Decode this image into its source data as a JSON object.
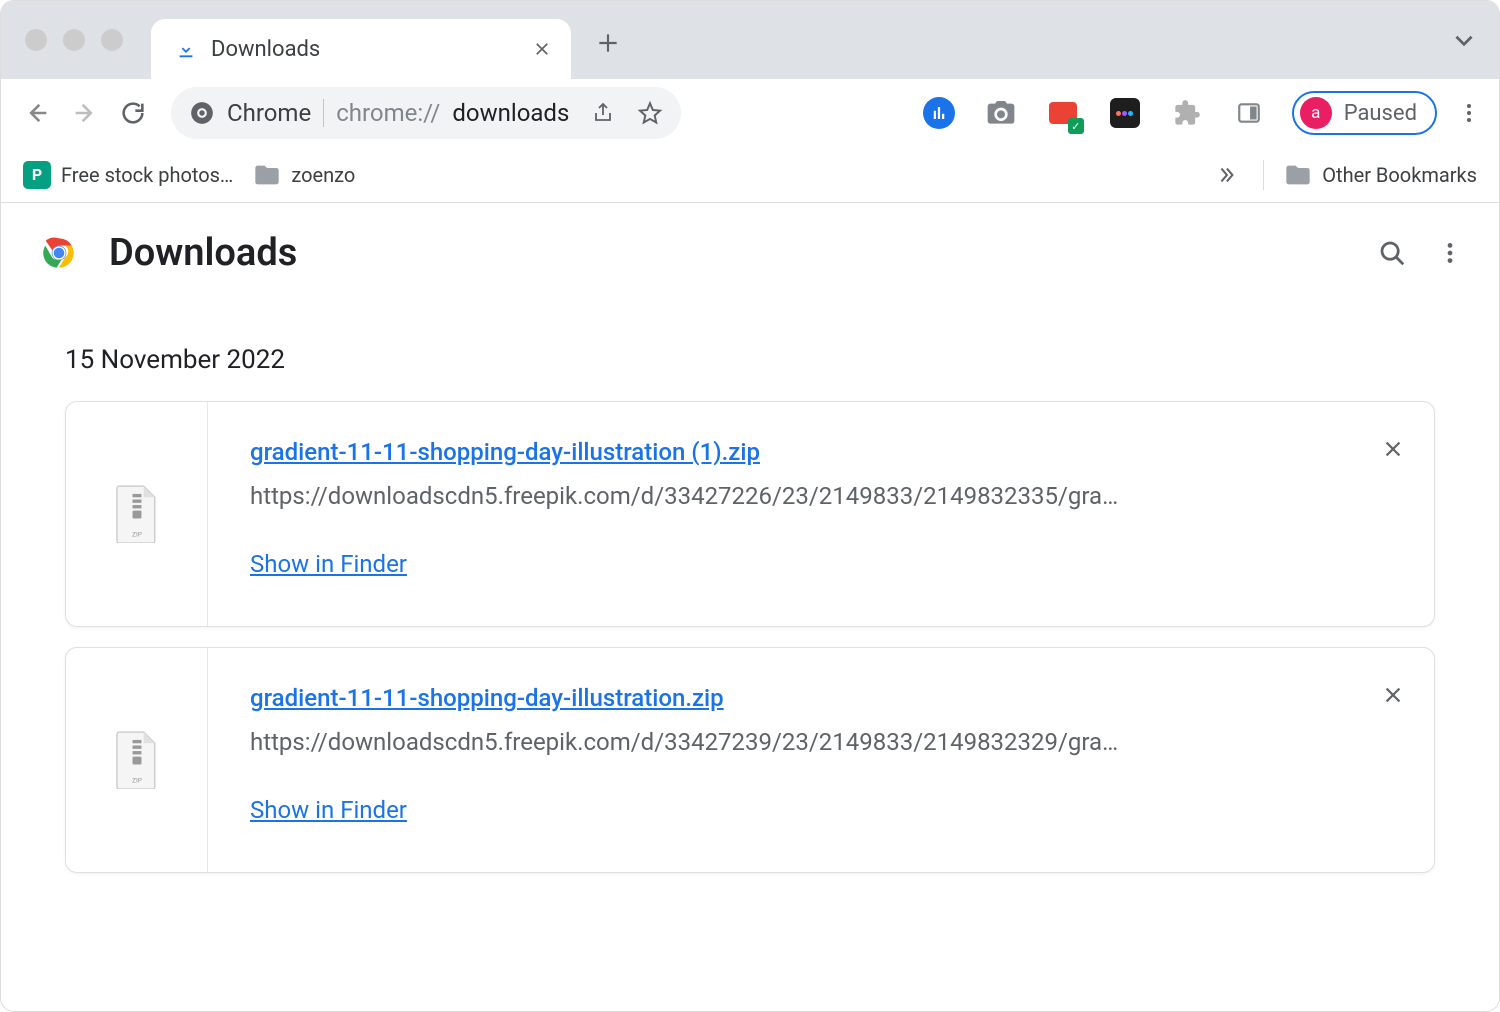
{
  "tab": {
    "title": "Downloads"
  },
  "address": {
    "brand": "Chrome",
    "url_prefix": "chrome://",
    "url_path": "downloads"
  },
  "profile": {
    "initial": "a",
    "status": "Paused"
  },
  "bookmarks": {
    "items": [
      {
        "label": "Free stock photos…"
      },
      {
        "label": "zoenzo"
      }
    ],
    "other": "Other Bookmarks"
  },
  "page": {
    "title": "Downloads",
    "date": "15 November 2022",
    "show_in_finder": "Show in Finder",
    "downloads": [
      {
        "filename": "gradient-11-11-shopping-day-illustration (1).zip",
        "url": "https://downloadscdn5.freepik.com/d/33427226/23/2149833/2149832335/gradient…"
      },
      {
        "filename": "gradient-11-11-shopping-day-illustration.zip",
        "url": "https://downloadscdn5.freepik.com/d/33427239/23/2149833/2149832329/gradient…"
      }
    ]
  }
}
